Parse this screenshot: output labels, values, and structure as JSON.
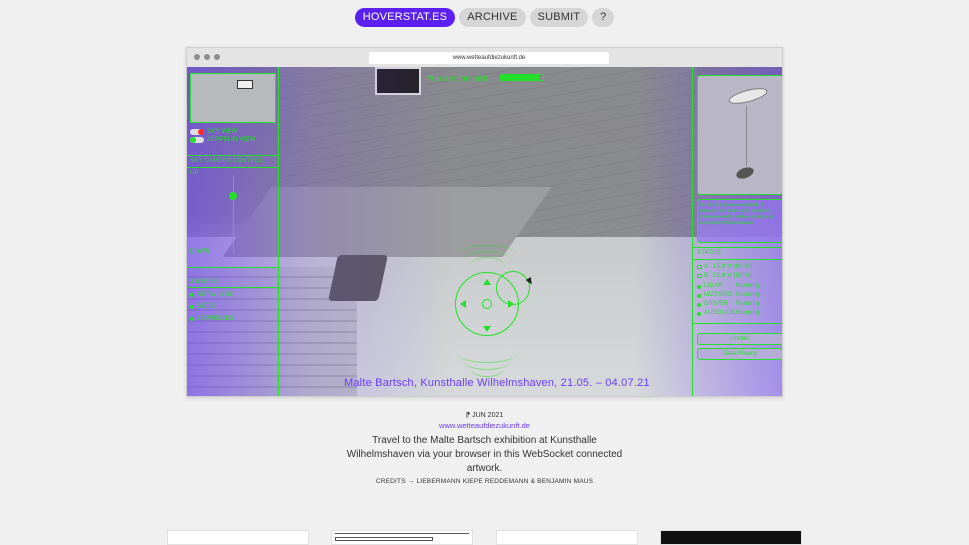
{
  "nav": {
    "items": [
      {
        "label": "HOVERSTAT.ES",
        "active": true
      },
      {
        "label": "ARCHIVE",
        "active": false
      },
      {
        "label": "SUBMIT",
        "active": false
      },
      {
        "label": "?",
        "active": false
      }
    ],
    "accent": "#5b1ff0"
  },
  "browser": {
    "url": "www.wetteaufdiezukunft.de"
  },
  "hud": {
    "color": "#25e02a",
    "pilot_text": "You are the pilot.",
    "pilot_level": 0.9,
    "views": [
      "SKY VIEW",
      "ZEPPELIN VIEW"
    ],
    "camera_title": "SKY CAMERA CONTROL",
    "up": "UP",
    "down": "DOWN",
    "users_title": "3 USERS",
    "users": [
      "BETA2 (YOU)",
      "BET33",
      "ZEPPELIN36"
    ],
    "info_text": "On the ride you see alongside a rebound. We angle trays, intelligent machines tend to add eta dynamic at Kunsthalle Wilhelmshaven.",
    "status_title": "STATUS",
    "batteries": [
      {
        "label": "A:",
        "value": "15.9 V  (90 %)"
      },
      {
        "label": "B:",
        "value": "15.8 V  (89 %)"
      }
    ],
    "systems": [
      {
        "name": "LIDAR",
        "state": "Running"
      },
      {
        "name": "MOTORS",
        "state": "Running"
      },
      {
        "name": "DRIVER",
        "state": "Running"
      },
      {
        "name": "AUSGUCK",
        "state": "Running"
      }
    ],
    "credits_btn": "Credits",
    "privacy_btn": "Data Privacy",
    "caption": "Malte Bartsch,  Kunsthalle Wilhelmshaven,  21.05. – 04.07.21"
  },
  "project": {
    "date": "JUN 2021",
    "link": "www.wetteaufdiezukunft.de",
    "description": "Travel to the Malte Bartsch exhibition at Kunsthalle Wilhelmshaven via your browser in this WebSocket connected artwork.",
    "credits": "CREDITS → LIEBERMANN KIEPE REDDEMANN & BENJAMIN MAUS"
  }
}
